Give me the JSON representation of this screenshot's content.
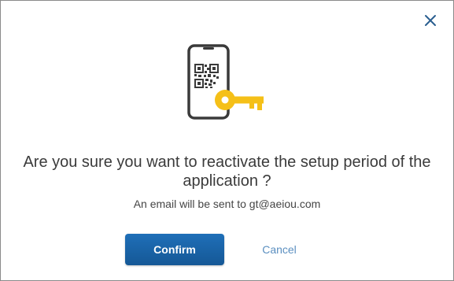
{
  "dialog": {
    "title": "Are you sure you want to reactivate the setup period of the application ?",
    "message": "An email will be sent to gt@aeiou.com",
    "confirm_label": "Confirm",
    "cancel_label": "Cancel",
    "close_icon": "close-icon",
    "illustration_icon": "phone-qr-key-icon"
  },
  "colors": {
    "primary": "#1a64a8",
    "link": "#5b8fc0",
    "key": "#f5c018",
    "phone_outline": "#3a3a3a",
    "text": "#3b3b3b"
  }
}
